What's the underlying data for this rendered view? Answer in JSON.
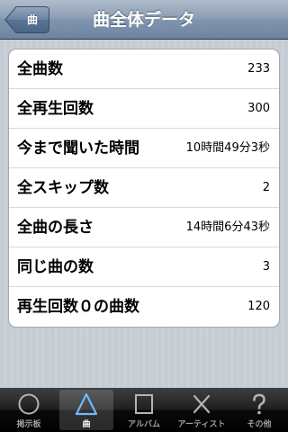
{
  "navbar": {
    "back_label": "曲",
    "title": "曲全体データ"
  },
  "stats": [
    {
      "label": "全曲数",
      "value": "233"
    },
    {
      "label": "全再生回数",
      "value": "300"
    },
    {
      "label": "今まで聞いた時間",
      "value": "10時間49分3秒"
    },
    {
      "label": "全スキップ数",
      "value": "2"
    },
    {
      "label": "全曲の長さ",
      "value": "14時間6分43秒"
    },
    {
      "label": "同じ曲の数",
      "value": "3"
    },
    {
      "label": "再生回数０の曲数",
      "value": "120"
    }
  ],
  "tabbar": {
    "selected": "曲",
    "items": [
      {
        "label": "掲示板",
        "icon": "circle-icon"
      },
      {
        "label": "曲",
        "icon": "triangle-icon"
      },
      {
        "label": "アルバム",
        "icon": "square-icon"
      },
      {
        "label": "アーティスト",
        "icon": "cross-icon"
      },
      {
        "label": "その他",
        "icon": "question-icon"
      }
    ]
  },
  "colors": {
    "navbar": "#7a8fab",
    "background": "#c5ccd4",
    "selected_tab_icon": "#6fb8ff"
  }
}
